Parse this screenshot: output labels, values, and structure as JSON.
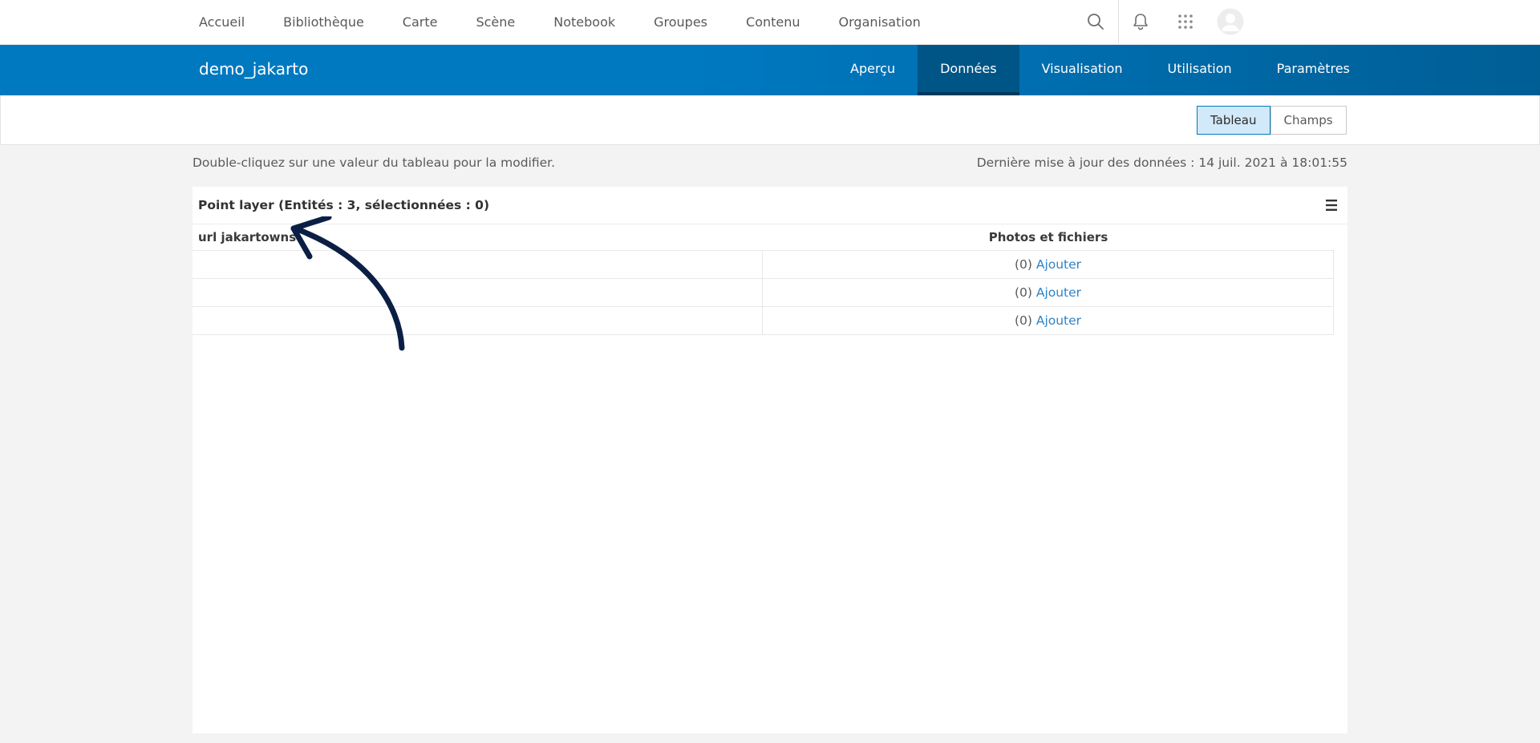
{
  "topnav": {
    "links": [
      "Accueil",
      "Bibliothèque",
      "Carte",
      "Scène",
      "Notebook",
      "Groupes",
      "Contenu",
      "Organisation"
    ],
    "icons": [
      "search-icon",
      "bell-icon",
      "apps-grid-icon",
      "avatar"
    ]
  },
  "item": {
    "title": "demo_jakarto",
    "tabs": [
      "Aperçu",
      "Données",
      "Visualisation",
      "Utilisation",
      "Paramètres"
    ],
    "active_tab": "Données"
  },
  "view_toggle": {
    "table_label": "Tableau",
    "fields_label": "Champs",
    "selected": "Tableau"
  },
  "info": {
    "hint": "Double-cliquez sur une valeur du tableau pour la modifier.",
    "last_updated": "Dernière mise à jour des données : 14 juil. 2021 à 18:01:55"
  },
  "table": {
    "title": "Point layer (Entités : 3, sélectionnées : 0)",
    "columns": [
      "url jakartowns",
      "Photos et fichiers"
    ],
    "rows": [
      {
        "url": "",
        "count": "(0)",
        "action": "Ajouter"
      },
      {
        "url": "",
        "count": "(0)",
        "action": "Ajouter"
      },
      {
        "url": "",
        "count": "(0)",
        "action": "Ajouter"
      }
    ]
  },
  "colors": {
    "brand_blue": "#0079c1",
    "active_tab": "#005587",
    "link": "#2e83c8",
    "annotation": "#0b1f45"
  }
}
